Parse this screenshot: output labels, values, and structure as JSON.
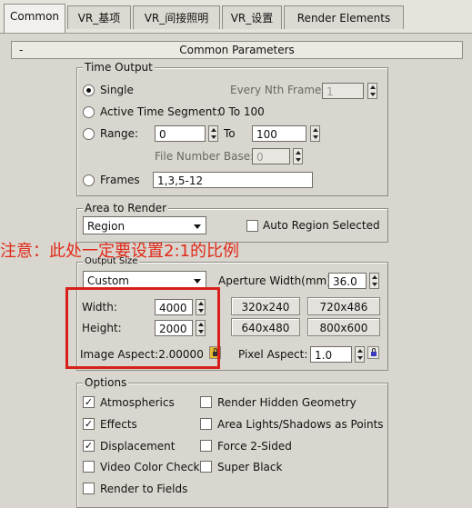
{
  "tabs": [
    "Common",
    "VR_基项",
    "VR_间接照明",
    "VR_设置",
    "Render Elements"
  ],
  "rollout": {
    "minus": "-",
    "title": "Common Parameters"
  },
  "time_output": {
    "title": "Time Output",
    "single": "Single",
    "every_nth": "Every Nth Frame:",
    "every_nth_value": "1",
    "active_segment": "Active Time Segment:",
    "active_segment_value": "0 To 100",
    "range": "Range:",
    "range_from": "0",
    "range_to_label": "To",
    "range_to": "100",
    "file_number_base": "File Number Base:",
    "file_number_base_value": "0",
    "frames": "Frames",
    "frames_value": "1,3,5-12"
  },
  "area_to_render": {
    "title": "Area to Render",
    "selected": "Region",
    "auto_region": "Auto Region Selected"
  },
  "annotation": "注意：此处一定要设置2:1的比例",
  "output_size": {
    "title": "Output Size",
    "preset": "Custom",
    "aperture_label": "Aperture Width(mm):",
    "aperture_value": "36.0",
    "width_label": "Width:",
    "width_value": "4000",
    "height_label": "Height:",
    "height_value": "2000",
    "presets": [
      "320x240",
      "720x486",
      "640x480",
      "800x600"
    ],
    "image_aspect": "Image Aspect:2.00000",
    "pixel_aspect_label": "Pixel Aspect:",
    "pixel_aspect_value": "1.0"
  },
  "options": {
    "title": "Options",
    "left": [
      {
        "label": "Atmospherics",
        "checked": true
      },
      {
        "label": "Effects",
        "checked": true
      },
      {
        "label": "Displacement",
        "checked": true
      },
      {
        "label": "Video Color Check",
        "checked": false
      },
      {
        "label": "Render to Fields",
        "checked": false
      }
    ],
    "right": [
      {
        "label": "Render Hidden Geometry",
        "checked": false
      },
      {
        "label": "Area Lights/Shadows as Points",
        "checked": false
      },
      {
        "label": "Force 2-Sided",
        "checked": false
      },
      {
        "label": "Super Black",
        "checked": false
      }
    ]
  },
  "colors": {
    "annotation": "#e02a1a",
    "highlight_box": "#d8201a",
    "lock_active": "#e8b830"
  }
}
